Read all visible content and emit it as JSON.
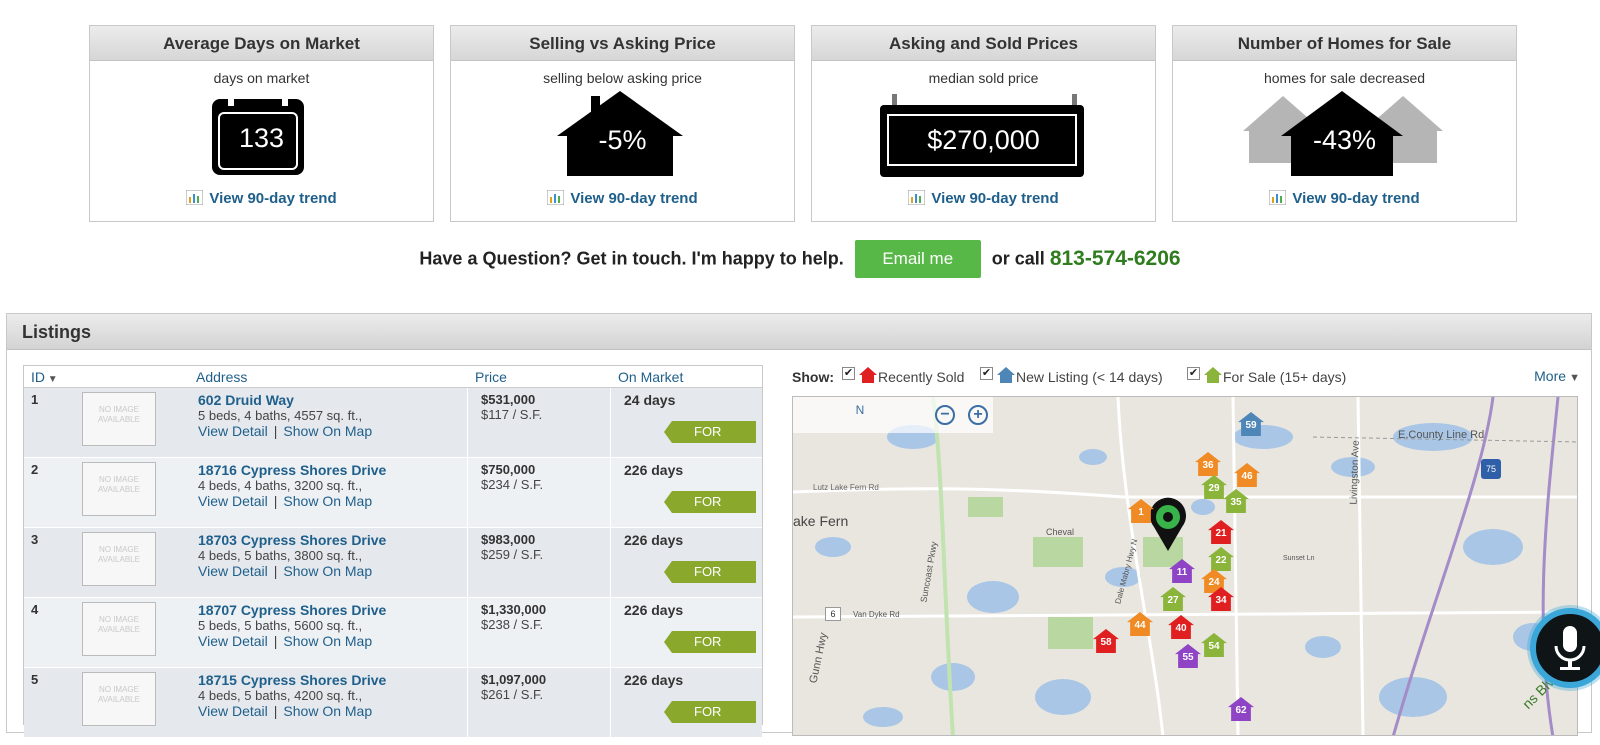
{
  "stats": [
    {
      "title": "Average Days on Market",
      "subtitle": "days on market",
      "value": "133",
      "icon": "calendar-icon",
      "trend": "View 90-day trend"
    },
    {
      "title": "Selling vs Asking Price",
      "subtitle": "selling below asking price",
      "value": "-5%",
      "icon": "house-icon",
      "trend": "View 90-day trend"
    },
    {
      "title": "Asking and Sold Prices",
      "subtitle": "median sold price",
      "value": "$270,000",
      "icon": "sign-icon",
      "trend": "View 90-day trend"
    },
    {
      "title": "Number of Homes for Sale",
      "subtitle": "homes for sale decreased",
      "value": "-43%",
      "icon": "houses-icon",
      "trend": "View 90-day trend"
    }
  ],
  "contact": {
    "question": "Have a Question? Get in touch. I'm happy to help.",
    "email_label": "Email me",
    "or_call": "or call",
    "phone": "813-574-6206"
  },
  "listings": {
    "title": "Listings",
    "columns": {
      "id": "ID",
      "address": "Address",
      "price": "Price",
      "market": "On Market"
    },
    "no_image": "NO IMAGE AVAILABLE",
    "view_detail": "View Detail",
    "show_on_map": "Show On Map",
    "badge": "FOR SALE",
    "rows": [
      {
        "id": "1",
        "address": "602 Druid Way",
        "details": "5 beds, 4 baths, 4557 sq. ft.,",
        "price": "$531,000",
        "psf": "$117 / S.F.",
        "market": "24 days"
      },
      {
        "id": "2",
        "address": "18716 Cypress Shores Drive",
        "details": "4 beds, 4 baths, 3200 sq. ft.,",
        "price": "$750,000",
        "psf": "$234 / S.F.",
        "market": "226 days"
      },
      {
        "id": "3",
        "address": "18703 Cypress Shores Drive",
        "details": "4 beds, 5 baths, 3800 sq. ft.,",
        "price": "$983,000",
        "psf": "$259 / S.F.",
        "market": "226 days"
      },
      {
        "id": "4",
        "address": "18707 Cypress Shores Drive",
        "details": "5 beds, 5 baths, 5600 sq. ft.,",
        "price": "$1,330,000",
        "psf": "$238 / S.F.",
        "market": "226 days"
      },
      {
        "id": "5",
        "address": "18715 Cypress Shores Drive",
        "details": "4 beds, 5 baths, 4200 sq. ft.,",
        "price": "$1,097,000",
        "psf": "$261 / S.F.",
        "market": "226 days"
      }
    ]
  },
  "map": {
    "show_label": "Show:",
    "legend": [
      {
        "label": "Recently  Sold",
        "color": "#e02020"
      },
      {
        "label": "New Listing (< 14 days)",
        "color": "#4f86b8"
      },
      {
        "label": "For Sale (15+ days)",
        "color": "#8ab43a"
      }
    ],
    "more": "More",
    "compass": "N",
    "labels": {
      "county_line": "E.County Line Rd",
      "livingston": "Livingston Ave",
      "lake_fern": "ake Fern",
      "lutz": "Lutz Lake Fern Rd",
      "cheval": "Cheval",
      "suncoast": "Suncoast Pkwy",
      "van_dyke": "Van Dyke Rd",
      "dale_mabry": "Dale Mabry Hwy N",
      "gunn": "Gunn Hwy",
      "sunset": "Sunset Ln",
      "shield_75": "75",
      "route_6": "6",
      "blvd": "ns Blvd"
    },
    "markers": [
      {
        "n": "59",
        "c": "#4f86b8"
      },
      {
        "n": "36",
        "c": "#f08a24"
      },
      {
        "n": "46",
        "c": "#f08a24"
      },
      {
        "n": "29",
        "c": "#8ab43a"
      },
      {
        "n": "35",
        "c": "#8ab43a"
      },
      {
        "n": "21",
        "c": "#e02020"
      },
      {
        "n": "22",
        "c": "#8ab43a"
      },
      {
        "n": "11",
        "c": "#8e44c4"
      },
      {
        "n": "24",
        "c": "#f08a24"
      },
      {
        "n": "27",
        "c": "#8ab43a"
      },
      {
        "n": "34",
        "c": "#e02020"
      },
      {
        "n": "44",
        "c": "#f08a24"
      },
      {
        "n": "40",
        "c": "#e02020"
      },
      {
        "n": "58",
        "c": "#e02020"
      },
      {
        "n": "55",
        "c": "#8e44c4"
      },
      {
        "n": "54",
        "c": "#8ab43a"
      },
      {
        "n": "62",
        "c": "#8e44c4"
      },
      {
        "n": "1",
        "c": "#f08a24"
      }
    ]
  }
}
